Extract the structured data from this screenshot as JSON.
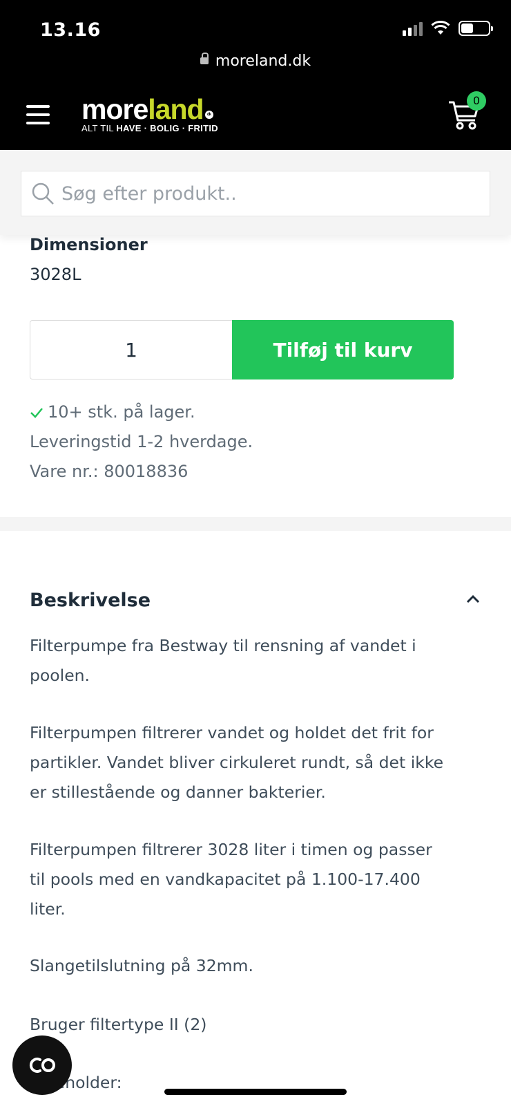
{
  "status_bar": {
    "time": "13.16"
  },
  "browser": {
    "url": "moreland.dk"
  },
  "header": {
    "logo_more": "more",
    "logo_land": "land",
    "logo_dk": "dk",
    "tagline_prefix": "ALT TIL ",
    "tagline_bold": "HAVE · BOLIG · FRITID",
    "cart_count": "0"
  },
  "search": {
    "placeholder": "Søg efter produkt.."
  },
  "product": {
    "dimensions_label": "Dimensioner",
    "dimensions_value": "3028L",
    "quantity": "1",
    "add_to_cart_label": "Tilføj til kurv",
    "stock_text": "10+ stk. på lager.",
    "delivery_text": "Leveringstid 1-2 hverdage.",
    "item_number_text": "Vare nr.: 80018836"
  },
  "description": {
    "title": "Beskrivelse",
    "paragraphs": [
      "Filterpumpe fra Bestway til rensning af vandet i poolen.",
      "Filterpumpen filtrerer vandet og holdet det frit for partikler. Vandet bliver cirkuleret rundt, så det ikke er stillestående og danner bakterier.",
      "Filterpumpen filtrerer 3028 liter i timen og passer til pools med en vandkapacitet på 1.100-17.400 liter.",
      "Slangetilslutning på 32mm.",
      "Bruger filtertype II (2)",
      "Indeholder:"
    ]
  },
  "colors": {
    "accent_green": "#22c55a",
    "logo_yellow": "#c7d82a",
    "badge_green": "#2fcc63"
  },
  "icons": {
    "menu": "hamburger-icon",
    "cart": "cart-icon",
    "search": "search-icon",
    "stock": "check-icon",
    "collapse": "chevron-up-icon",
    "chat": "chat-icon"
  }
}
